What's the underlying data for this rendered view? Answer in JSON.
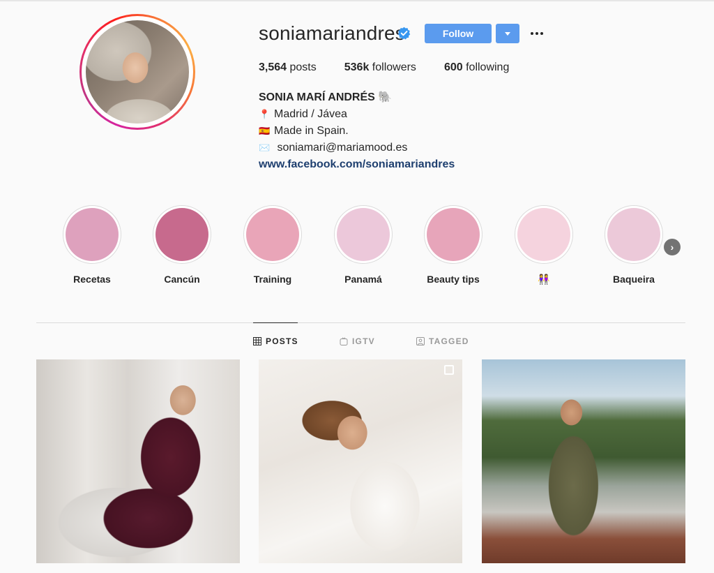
{
  "profile": {
    "username": "soniamariandres",
    "verified": true,
    "follow_label": "Follow",
    "stats": {
      "posts_count": "3,564",
      "posts_label": "posts",
      "followers_count": "536k",
      "followers_label": "followers",
      "following_count": "600",
      "following_label": "following"
    },
    "bio": {
      "name": "SONIA MARÍ ANDRÉS 🐘",
      "location": "Madrid / Jávea",
      "origin": "Made in Spain.",
      "email": "soniamari@mariamood.es",
      "link": "www.facebook.com/soniamariandres"
    },
    "emojis": {
      "location": "📍",
      "flag": "🇪🇸",
      "mail": "✉️"
    }
  },
  "highlights": [
    {
      "label": "Recetas",
      "color": "#dea1bd"
    },
    {
      "label": "Cancún",
      "color": "#c76a8d"
    },
    {
      "label": "Training",
      "color": "#e9a5b8"
    },
    {
      "label": "Panamá",
      "color": "#ecc8da"
    },
    {
      "label": "Beauty tips",
      "color": "#e7a5ba"
    },
    {
      "label": "👭",
      "color": "#f5d3de"
    },
    {
      "label": "Baqueira",
      "color": "#ecc9d9"
    }
  ],
  "tabs": [
    {
      "label": "POSTS",
      "icon": "grid-icon",
      "active": true
    },
    {
      "label": "IGTV",
      "icon": "igtv-icon",
      "active": false
    },
    {
      "label": "TAGGED",
      "icon": "tagged-icon",
      "active": false
    }
  ],
  "colors": {
    "accent": "#5b9bee",
    "link": "#1e3f6f",
    "verified": "#3897f0"
  }
}
